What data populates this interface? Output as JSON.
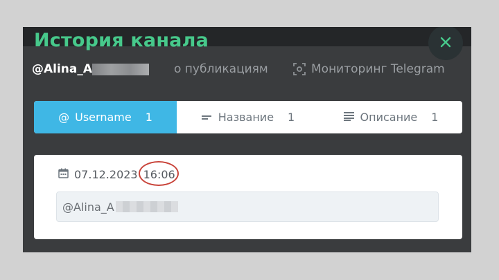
{
  "modal": {
    "title": "История канала",
    "owner_handle": "@Alina_A",
    "partial_label": "о публикациям",
    "monitor_label": "Мониторинг Telegram"
  },
  "tabs": [
    {
      "icon": "at-icon",
      "symbol": "@",
      "label": "Username",
      "count": "1",
      "active": true
    },
    {
      "icon": "title-lines-icon",
      "label": "Название",
      "count": "1",
      "active": false
    },
    {
      "icon": "text-lines-icon",
      "label": "Описание",
      "count": "1",
      "active": false
    }
  ],
  "history_entry": {
    "date": "07.12.2023",
    "time": "16:06",
    "value": "@Alina_A"
  },
  "colors": {
    "accent_green": "#47c98b",
    "active_tab": "#3fb7e5",
    "annotation_circle": "#c9443a"
  }
}
